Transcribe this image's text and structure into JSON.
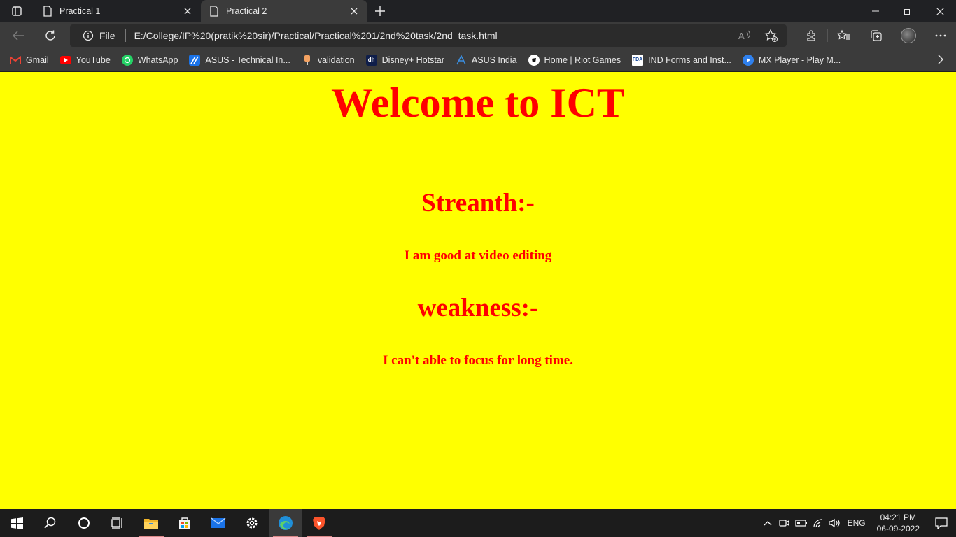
{
  "browser": {
    "tabs": [
      {
        "title": "Practical 1",
        "active": false
      },
      {
        "title": "Practical 2",
        "active": true
      }
    ],
    "address": {
      "scheme_label": "File",
      "url": "E:/College/IP%20(pratik%20sir)/Practical/Practical%201/2nd%20task/2nd_task.html"
    },
    "bookmarks": [
      {
        "label": "Gmail",
        "icon": "gmail-icon",
        "color": "#ea4335"
      },
      {
        "label": "YouTube",
        "icon": "youtube-icon",
        "color": "#ff0000"
      },
      {
        "label": "WhatsApp",
        "icon": "whatsapp-icon",
        "color": "#25d366"
      },
      {
        "label": "ASUS - Technical In...",
        "icon": "asus-icon",
        "color": "#1a73e8"
      },
      {
        "label": "validation",
        "icon": "validation-icon",
        "color": "#f4a261"
      },
      {
        "label": "Disney+ Hotstar",
        "icon": "hotstar-icon",
        "color": "#0f1e4a"
      },
      {
        "label": "ASUS India",
        "icon": "asus-india-icon",
        "color": "#3a8dde"
      },
      {
        "label": "Home | Riot Games",
        "icon": "riot-icon",
        "color": "#111111"
      },
      {
        "label": "IND Forms and Inst...",
        "icon": "fda-icon",
        "color": "#ffffff"
      },
      {
        "label": "MX Player - Play M...",
        "icon": "mxplayer-icon",
        "color": "#2f80ed"
      }
    ]
  },
  "page": {
    "background": "#ffff00",
    "text_color": "#ff0000",
    "title": "Welcome to ICT",
    "strength_heading": "Streanth:-",
    "strength_text": "I am good at video editing",
    "weakness_heading": "weakness:-",
    "weakness_text": "I can't able to focus for long time."
  },
  "taskbar": {
    "apps": [
      "start-icon",
      "search-icon",
      "cortana-icon",
      "task-view-icon",
      "file-explorer-icon",
      "store-icon",
      "mail-icon",
      "settings-icon",
      "edge-icon",
      "brave-icon"
    ],
    "tray": {
      "language": "ENG",
      "time": "04:21 PM",
      "date": "06-09-2022"
    }
  }
}
